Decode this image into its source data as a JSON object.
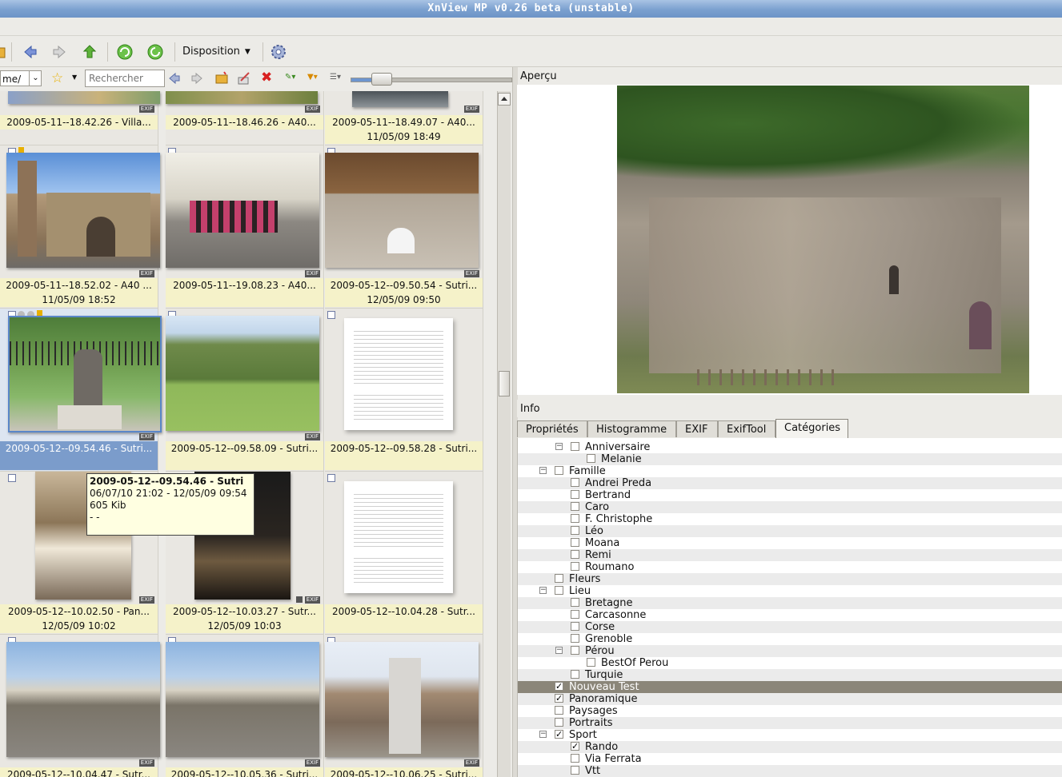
{
  "window": {
    "title": "XnView MP v0.26 beta (unstable)"
  },
  "toolbar": {
    "layout_label": "Disposition"
  },
  "filterbar": {
    "path": "me/",
    "search_placeholder": "Rechercher"
  },
  "thumbnails": [
    {
      "caption": "2009-05-11--18.42.26 - Villa...",
      "date": ""
    },
    {
      "caption": "2009-05-11--18.46.26 - A40...",
      "date": ""
    },
    {
      "caption": "2009-05-11--18.49.07 - A40...",
      "date": "11/05/09 18:49"
    },
    {
      "caption": "2009-05-11--18.52.02 - A40 ...",
      "date": "11/05/09 18:52"
    },
    {
      "caption": "2009-05-11--19.08.23 - A40...",
      "date": ""
    },
    {
      "caption": "2009-05-12--09.50.54 - Sutri...",
      "date": "12/05/09 09:50"
    },
    {
      "caption": "2009-05-12--09.54.46 - Sutri...",
      "date": ""
    },
    {
      "caption": "2009-05-12--09.58.09 - Sutri...",
      "date": ""
    },
    {
      "caption": "2009-05-12--09.58.28 - Sutri...",
      "date": ""
    },
    {
      "caption": "2009-05-12--10.02.50 - Pan...",
      "date": "12/05/09 10:02"
    },
    {
      "caption": "2009-05-12--10.03.27 - Sutr...",
      "date": "12/05/09 10:03"
    },
    {
      "caption": "2009-05-12--10.04.28 - Sutr...",
      "date": ""
    },
    {
      "caption": "2009-05-12--10.04.47 - Sutr...",
      "date": ""
    },
    {
      "caption": "2009-05-12--10.05.36 - Sutri...",
      "date": ""
    },
    {
      "caption": "2009-05-12--10.06.25 - Sutri...",
      "date": ""
    }
  ],
  "exif_badge": "EXIF",
  "tooltip": {
    "title": "2009-05-12--09.54.46 - Sutri",
    "dates": "06/07/10 21:02 - 12/05/09 09:54",
    "size": "605 Kib",
    "extra": "- -"
  },
  "preview": {
    "label": "Aperçu"
  },
  "info": {
    "label": "Info",
    "tabs": [
      "Propriétés",
      "Histogramme",
      "EXIF",
      "ExifTool",
      "Catégories"
    ],
    "active_tab": "Catégories"
  },
  "categories": [
    {
      "label": "Anniversaire",
      "level": 2,
      "expander": true,
      "checked": false
    },
    {
      "label": "Melanie",
      "level": 3,
      "expander": false,
      "checked": false
    },
    {
      "label": "Famille",
      "level": 1,
      "expander": true,
      "checked": false
    },
    {
      "label": "Andrei Preda",
      "level": 2,
      "expander": false,
      "checked": false
    },
    {
      "label": "Bertrand",
      "level": 2,
      "expander": false,
      "checked": false
    },
    {
      "label": "Caro",
      "level": 2,
      "expander": false,
      "checked": false
    },
    {
      "label": "F. Christophe",
      "level": 2,
      "expander": false,
      "checked": false
    },
    {
      "label": "Léo",
      "level": 2,
      "expander": false,
      "checked": false
    },
    {
      "label": "Moana",
      "level": 2,
      "expander": false,
      "checked": false
    },
    {
      "label": "Remi",
      "level": 2,
      "expander": false,
      "checked": false
    },
    {
      "label": "Roumano",
      "level": 2,
      "expander": false,
      "checked": false
    },
    {
      "label": "Fleurs",
      "level": 1,
      "expander": false,
      "checked": false
    },
    {
      "label": "Lieu",
      "level": 1,
      "expander": true,
      "checked": false
    },
    {
      "label": "Bretagne",
      "level": 2,
      "expander": false,
      "checked": false
    },
    {
      "label": "Carcasonne",
      "level": 2,
      "expander": false,
      "checked": false
    },
    {
      "label": "Corse",
      "level": 2,
      "expander": false,
      "checked": false
    },
    {
      "label": "Grenoble",
      "level": 2,
      "expander": false,
      "checked": false
    },
    {
      "label": "Pérou",
      "level": 2,
      "expander": true,
      "checked": false
    },
    {
      "label": "BestOf Perou",
      "level": 3,
      "expander": false,
      "checked": false
    },
    {
      "label": "Turquie",
      "level": 2,
      "expander": false,
      "checked": false
    },
    {
      "label": "Nouveau Test",
      "level": 1,
      "expander": false,
      "checked": true,
      "highlight": true
    },
    {
      "label": "Panoramique",
      "level": 1,
      "expander": false,
      "checked": true
    },
    {
      "label": "Paysages",
      "level": 1,
      "expander": false,
      "checked": false
    },
    {
      "label": "Portraits",
      "level": 1,
      "expander": false,
      "checked": false
    },
    {
      "label": "Sport",
      "level": 1,
      "expander": true,
      "checked": true
    },
    {
      "label": "Rando",
      "level": 2,
      "expander": false,
      "checked": true
    },
    {
      "label": "Via Ferrata",
      "level": 2,
      "expander": false,
      "checked": false
    },
    {
      "label": "Vtt",
      "level": 2,
      "expander": false,
      "checked": false
    }
  ],
  "colors": {
    "title_bar": "#7ba0cf",
    "caption_bg": "#f5f2c9",
    "selection": "#7b9ccb",
    "tree_highlight": "#8b8679"
  }
}
